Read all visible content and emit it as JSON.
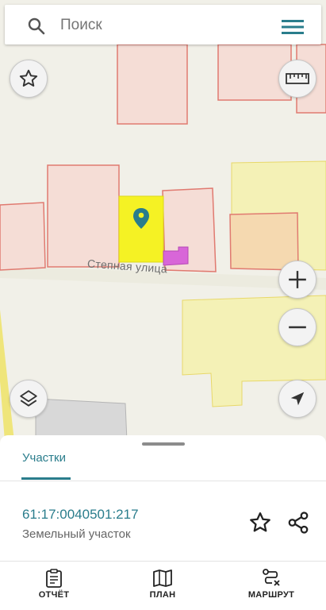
{
  "search": {
    "placeholder": "Поиск"
  },
  "map": {
    "street_name": "Степная улица",
    "colors": {
      "background": "#f1f0e8",
      "parcel_fill": "#f5ddd6",
      "parcel_border": "#e07a70",
      "selected_parcel": "#f5f224",
      "yellow_zone": "#f4f1b6",
      "building_pink": "#d866d8",
      "pin": "#2a7d8c",
      "road": "#e9e6c9"
    },
    "controls": {
      "favorite": "star-outline-icon",
      "ruler": "ruler-icon",
      "zoom_in": "plus-icon",
      "zoom_out": "minus-icon",
      "layers": "layers-icon",
      "locate": "navigation-arrow-icon"
    }
  },
  "sheet": {
    "tab_label": "Участки",
    "parcel": {
      "cadastral_number": "61:17:0040501:217",
      "type": "Земельный участок"
    }
  },
  "bottom_nav": {
    "report_label": "ОТЧЁТ",
    "plan_label": "ПЛАН",
    "route_label": "МАРШРУТ"
  },
  "accent_color": "#2a7d8c"
}
